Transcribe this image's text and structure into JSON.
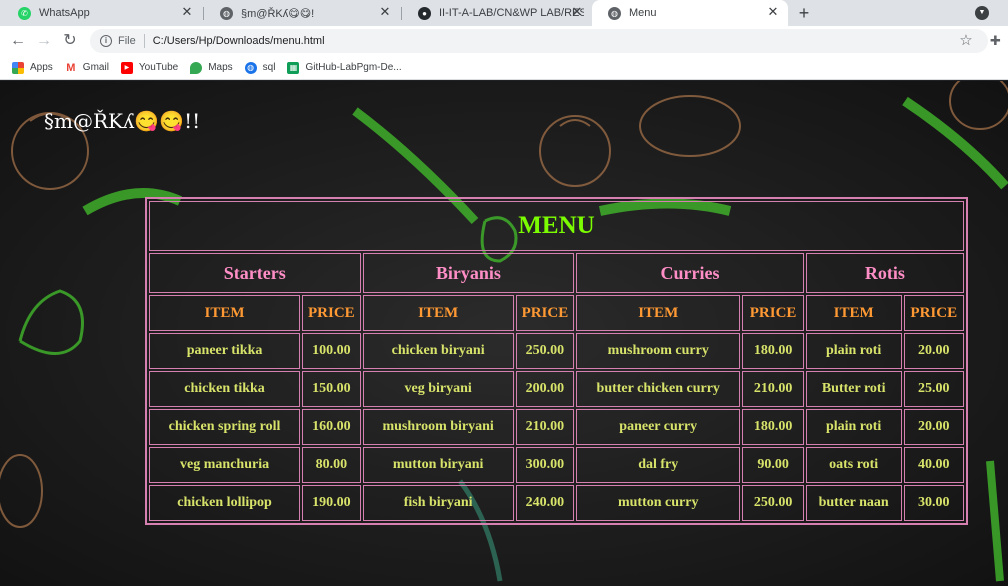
{
  "browser": {
    "tabs": [
      {
        "title": "WhatsApp",
        "icon": "whatsapp-icon"
      },
      {
        "title": "§m@ŘKʎ😋😋!",
        "icon": "globe-icon"
      },
      {
        "title": "II-IT-A-LAB/CN&WP LAB/RESTAU",
        "icon": "github-icon"
      },
      {
        "title": "Menu",
        "icon": "globe-icon"
      }
    ],
    "active_tab": 3,
    "address": {
      "scheme": "File",
      "url": "C:/Users/Hp/Downloads/menu.html"
    },
    "bookmarks": [
      {
        "label": "Apps",
        "icon": "apps-grid-icon"
      },
      {
        "label": "Gmail",
        "icon": "gmail-icon"
      },
      {
        "label": "YouTube",
        "icon": "youtube-icon"
      },
      {
        "label": "Maps",
        "icon": "maps-icon"
      },
      {
        "label": "sql",
        "icon": "globe-icon"
      },
      {
        "label": "GitHub-LabPgm-De...",
        "icon": "sheets-icon"
      }
    ]
  },
  "page": {
    "brand": "§m@ŘKʎ😋😋!!",
    "menu": {
      "caption": "MENU",
      "categories": [
        "Starters",
        "Biryanis",
        "Curries",
        "Rotis"
      ],
      "item_header": "ITEM",
      "price_header": "PRICE",
      "rows": [
        [
          [
            "paneer tikka",
            "100.00"
          ],
          [
            "chicken biryani",
            "250.00"
          ],
          [
            "mushroom curry",
            "180.00"
          ],
          [
            "plain roti",
            "20.00"
          ]
        ],
        [
          [
            "chicken tikka",
            "150.00"
          ],
          [
            "veg biryani",
            "200.00"
          ],
          [
            "butter chicken curry",
            "210.00"
          ],
          [
            "Butter roti",
            "25.00"
          ]
        ],
        [
          [
            "chicken spring roll",
            "160.00"
          ],
          [
            "mushroom biryani",
            "210.00"
          ],
          [
            "paneer curry",
            "180.00"
          ],
          [
            "plain roti",
            "20.00"
          ]
        ],
        [
          [
            "veg manchuria",
            "80.00"
          ],
          [
            "mutton biryani",
            "300.00"
          ],
          [
            "dal fry",
            "90.00"
          ],
          [
            "oats roti",
            "40.00"
          ]
        ],
        [
          [
            "chicken lollipop",
            "190.00"
          ],
          [
            "fish biryani",
            "240.00"
          ],
          [
            "mutton curry",
            "250.00"
          ],
          [
            "butter naan",
            "30.00"
          ]
        ]
      ]
    }
  },
  "colors": {
    "caption": "#7cfc00",
    "category": "#ff8ec6",
    "header": "#ff9933",
    "cell": "#d8e36a",
    "border": "#d67fb1",
    "background": "#1c1c1c"
  }
}
